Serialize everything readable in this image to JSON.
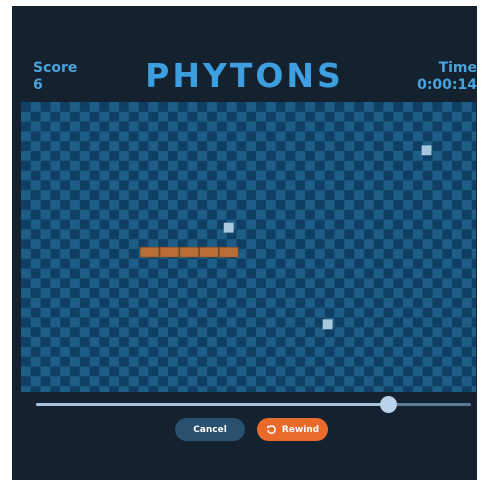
{
  "header": {
    "score_label": "Score",
    "score_value": "6",
    "title": "PHYTONS",
    "time_label": "Time",
    "time_value": "0:00:14"
  },
  "board": {
    "cols": 23,
    "rows": 15,
    "snake_color": "#b96e36",
    "food_color": "#a8c8de",
    "snake": [
      [
        6,
        7
      ],
      [
        7,
        7
      ],
      [
        8,
        7
      ],
      [
        9,
        7
      ],
      [
        10,
        7
      ]
    ],
    "food": [
      [
        10,
        6
      ],
      [
        20,
        2
      ],
      [
        15,
        11
      ]
    ]
  },
  "playback": {
    "progress": 0.81
  },
  "controls": {
    "cancel_label": "Cancel",
    "rewind_label": "Rewind",
    "rewind_icon": "rewind-icon",
    "accent": "#ea6a2c"
  }
}
